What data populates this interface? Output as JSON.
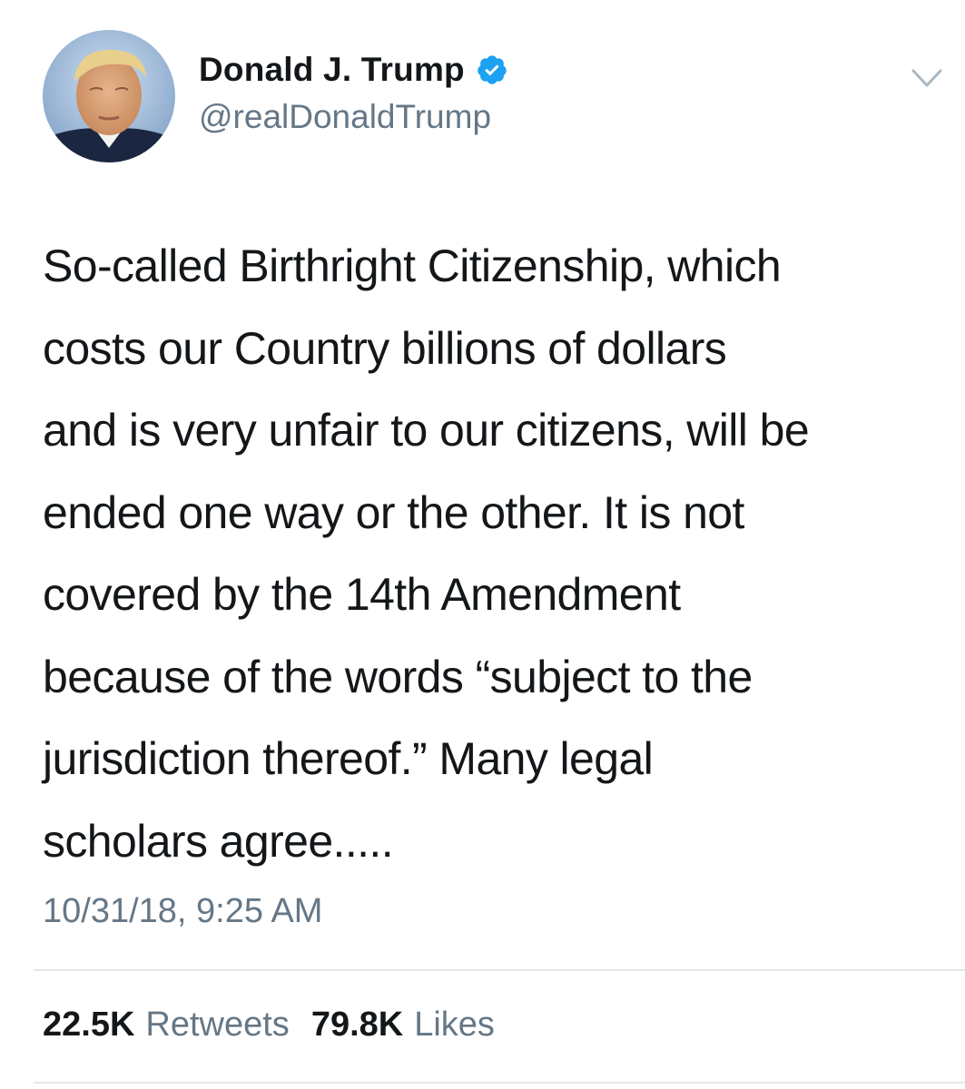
{
  "author": {
    "display_name": "Donald J. Trump",
    "handle": "@realDonaldTrump",
    "verified": true
  },
  "tweet": {
    "text": "So-called Birthright Citizenship, which\ncosts our Country billions of dollars\nand is very unfair to our citizens, will be\nended one way or the other. It is not\ncovered by the 14th Amendment\nbecause of the words “subject to the\njurisdiction thereof.” Many legal\nscholars agree.....",
    "timestamp": "10/31/18, 9:25 AM"
  },
  "stats": {
    "retweets_count": "22.5K",
    "retweets_label": "Retweets",
    "likes_count": "79.8K",
    "likes_label": "Likes"
  },
  "icons": {
    "verified": "verified-badge-icon",
    "menu": "chevron-down-icon"
  },
  "colors": {
    "text_primary": "#14171a",
    "text_secondary": "#657786",
    "verified_blue": "#1da1f2",
    "divider": "#e1e8ed",
    "chevron": "#aab8c2"
  }
}
